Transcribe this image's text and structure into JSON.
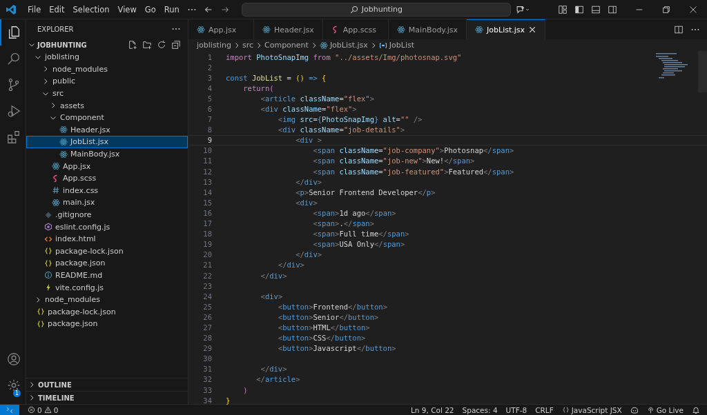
{
  "menu": [
    "File",
    "Edit",
    "Selection",
    "View",
    "Go",
    "Run"
  ],
  "search": {
    "value": "Jobhunting"
  },
  "activity": [
    {
      "kind": "explorer",
      "selected": true
    },
    {
      "kind": "search",
      "selected": false
    },
    {
      "kind": "source-control",
      "selected": false
    },
    {
      "kind": "run",
      "selected": false
    },
    {
      "kind": "extensions",
      "selected": false
    }
  ],
  "settings_badge": "1",
  "explorer": {
    "title": "EXPLORER",
    "root": {
      "label": "JOBHUNTING",
      "expanded": true
    },
    "tree": [
      {
        "label": "joblisting",
        "kind": "folder",
        "expanded": true,
        "selected": false,
        "children": [
          {
            "label": "node_modules",
            "kind": "folder",
            "expanded": false,
            "selected": false
          },
          {
            "label": "public",
            "kind": "folder",
            "expanded": false,
            "selected": false
          },
          {
            "label": "src",
            "kind": "folder",
            "expanded": true,
            "selected": false,
            "children": [
              {
                "label": "assets",
                "kind": "folder",
                "expanded": false,
                "selected": false
              },
              {
                "label": "Component",
                "kind": "folder",
                "expanded": true,
                "selected": false,
                "children": [
                  {
                    "label": "Header.jsx",
                    "kind": "react",
                    "selected": false
                  },
                  {
                    "label": "JobList.jsx",
                    "kind": "react",
                    "selected": true
                  },
                  {
                    "label": "MainBody.jsx",
                    "kind": "react",
                    "selected": false
                  }
                ]
              },
              {
                "label": "App.jsx",
                "kind": "react",
                "selected": false
              },
              {
                "label": "App.scss",
                "kind": "sass",
                "selected": false
              },
              {
                "label": "index.css",
                "kind": "css",
                "selected": false
              },
              {
                "label": "main.jsx",
                "kind": "react",
                "selected": false
              }
            ]
          },
          {
            "label": ".gitignore",
            "kind": "git",
            "selected": false
          },
          {
            "label": "eslint.config.js",
            "kind": "eslint",
            "selected": false
          },
          {
            "label": "index.html",
            "kind": "html",
            "selected": false
          },
          {
            "label": "package-lock.json",
            "kind": "json",
            "selected": false
          },
          {
            "label": "package.json",
            "kind": "json",
            "selected": false
          },
          {
            "label": "README.md",
            "kind": "info",
            "selected": false
          },
          {
            "label": "vite.config.js",
            "kind": "vite",
            "selected": false
          }
        ]
      },
      {
        "label": "node_modules",
        "kind": "folder",
        "expanded": false,
        "selected": false
      },
      {
        "label": "package-lock.json",
        "kind": "json",
        "selected": false
      },
      {
        "label": "package.json",
        "kind": "json",
        "selected": false
      }
    ],
    "sections": [
      {
        "label": "OUTLINE",
        "expanded": false
      },
      {
        "label": "TIMELINE",
        "expanded": false
      }
    ]
  },
  "tabs": [
    {
      "label": "App.jsx",
      "kind": "react",
      "selected": false
    },
    {
      "label": "Header.jsx",
      "kind": "react",
      "selected": false
    },
    {
      "label": "App.scss",
      "kind": "sass",
      "selected": false
    },
    {
      "label": "MainBody.jsx",
      "kind": "react",
      "selected": false
    },
    {
      "label": "JobList.jsx",
      "kind": "react",
      "selected": true
    }
  ],
  "breadcrumb": [
    {
      "label": "joblisting",
      "kind": "text"
    },
    {
      "label": "src",
      "kind": "text"
    },
    {
      "label": "Component",
      "kind": "text"
    },
    {
      "label": "JobList.jsx",
      "kind": "react"
    },
    {
      "label": "JobList",
      "kind": "symbol"
    }
  ],
  "code": [
    {
      "number": "1",
      "active": false,
      "tokens": [
        {
          "kind": "kw",
          "text": "import"
        },
        {
          "kind": "var",
          "text": " PhotoSnapImg"
        },
        {
          "kind": "kw",
          "text": " from"
        },
        {
          "kind": "str",
          "text": " \"../assets/Img/photosnap.svg\""
        }
      ]
    },
    {
      "number": "2",
      "active": false
    },
    {
      "number": "3",
      "active": false,
      "tokens": [
        {
          "kind": "decl",
          "text": "const"
        },
        {
          "kind": "fn",
          "text": " JobList"
        },
        {
          "kind": "op",
          "text": " = "
        },
        {
          "kind": "brace",
          "text": "()"
        },
        {
          "kind": "decl",
          "text": " =>"
        },
        {
          "kind": "brace",
          "text": " {"
        }
      ]
    },
    {
      "number": "4",
      "active": false,
      "tokens": [
        {
          "kind": "kw",
          "text": "    return"
        },
        {
          "kind": "paren",
          "text": "("
        }
      ]
    },
    {
      "number": "5",
      "active": false,
      "tokens": [
        {
          "kind": "tp",
          "text": "        <"
        },
        {
          "kind": "tag",
          "text": "article"
        },
        {
          "kind": "attr",
          "text": " className"
        },
        {
          "kind": "op",
          "text": "="
        },
        {
          "kind": "str",
          "text": "\"flex\""
        },
        {
          "kind": "tp",
          "text": ">"
        }
      ]
    },
    {
      "number": "6",
      "active": false,
      "tokens": [
        {
          "kind": "tp",
          "text": "        <"
        },
        {
          "kind": "tag",
          "text": "div"
        },
        {
          "kind": "attr",
          "text": " className"
        },
        {
          "kind": "op",
          "text": "="
        },
        {
          "kind": "str",
          "text": "\"flex\""
        },
        {
          "kind": "tp",
          "text": ">"
        }
      ]
    },
    {
      "number": "7",
      "active": false,
      "tokens": [
        {
          "kind": "tp",
          "text": "            <"
        },
        {
          "kind": "tag",
          "text": "img"
        },
        {
          "kind": "attr",
          "text": " src"
        },
        {
          "kind": "op",
          "text": "="
        },
        {
          "kind": "tag",
          "text": "{"
        },
        {
          "kind": "var",
          "text": "PhotoSnapImg"
        },
        {
          "kind": "tag",
          "text": "}"
        },
        {
          "kind": "attr",
          "text": " alt"
        },
        {
          "kind": "op",
          "text": "="
        },
        {
          "kind": "str",
          "text": "\"\""
        },
        {
          "kind": "tp",
          "text": " />"
        }
      ]
    },
    {
      "number": "8",
      "active": false,
      "tokens": [
        {
          "kind": "tp",
          "text": "            <"
        },
        {
          "kind": "tag",
          "text": "div"
        },
        {
          "kind": "attr",
          "text": " className"
        },
        {
          "kind": "op",
          "text": "="
        },
        {
          "kind": "str",
          "text": "\"job-details\""
        },
        {
          "kind": "tp",
          "text": ">"
        }
      ]
    },
    {
      "number": "9",
      "active": true,
      "tokens": [
        {
          "kind": "tp",
          "text": "                <"
        },
        {
          "kind": "tag",
          "text": "div"
        },
        {
          "kind": "tp",
          "text": " >"
        }
      ]
    },
    {
      "number": "10",
      "active": false,
      "tokens": [
        {
          "kind": "tp",
          "text": "                    <"
        },
        {
          "kind": "tag",
          "text": "span"
        },
        {
          "kind": "attr",
          "text": " className"
        },
        {
          "kind": "op",
          "text": "="
        },
        {
          "kind": "str",
          "text": "\"job-company\""
        },
        {
          "kind": "tp",
          "text": ">"
        },
        {
          "kind": "txt",
          "text": "Photosnap"
        },
        {
          "kind": "tp",
          "text": "</"
        },
        {
          "kind": "tag",
          "text": "span"
        },
        {
          "kind": "tp",
          "text": ">"
        }
      ]
    },
    {
      "number": "11",
      "active": false,
      "tokens": [
        {
          "kind": "tp",
          "text": "                    <"
        },
        {
          "kind": "tag",
          "text": "span"
        },
        {
          "kind": "attr",
          "text": " className"
        },
        {
          "kind": "op",
          "text": "="
        },
        {
          "kind": "str",
          "text": "\"job-new\""
        },
        {
          "kind": "tp",
          "text": ">"
        },
        {
          "kind": "txt",
          "text": "New!"
        },
        {
          "kind": "tp",
          "text": "</"
        },
        {
          "kind": "tag",
          "text": "span"
        },
        {
          "kind": "tp",
          "text": ">"
        }
      ]
    },
    {
      "number": "12",
      "active": false,
      "tokens": [
        {
          "kind": "tp",
          "text": "                    <"
        },
        {
          "kind": "tag",
          "text": "span"
        },
        {
          "kind": "attr",
          "text": " className"
        },
        {
          "kind": "op",
          "text": "="
        },
        {
          "kind": "str",
          "text": "\"job-featured\""
        },
        {
          "kind": "tp",
          "text": ">"
        },
        {
          "kind": "txt",
          "text": "Featured"
        },
        {
          "kind": "tp",
          "text": "</"
        },
        {
          "kind": "tag",
          "text": "span"
        },
        {
          "kind": "tp",
          "text": ">"
        }
      ]
    },
    {
      "number": "13",
      "active": false,
      "tokens": [
        {
          "kind": "tp",
          "text": "                </"
        },
        {
          "kind": "tag",
          "text": "div"
        },
        {
          "kind": "tp",
          "text": ">"
        }
      ]
    },
    {
      "number": "14",
      "active": false,
      "tokens": [
        {
          "kind": "tp",
          "text": "                <"
        },
        {
          "kind": "tag",
          "text": "p"
        },
        {
          "kind": "tp",
          "text": ">"
        },
        {
          "kind": "txt",
          "text": "Senior Frontend Developer"
        },
        {
          "kind": "tp",
          "text": "</"
        },
        {
          "kind": "tag",
          "text": "p"
        },
        {
          "kind": "tp",
          "text": ">"
        }
      ]
    },
    {
      "number": "15",
      "active": false,
      "tokens": [
        {
          "kind": "tp",
          "text": "                <"
        },
        {
          "kind": "tag",
          "text": "div"
        },
        {
          "kind": "tp",
          "text": ">"
        }
      ]
    },
    {
      "number": "16",
      "active": false,
      "tokens": [
        {
          "kind": "tp",
          "text": "                    <"
        },
        {
          "kind": "tag",
          "text": "span"
        },
        {
          "kind": "tp",
          "text": ">"
        },
        {
          "kind": "txt",
          "text": "1d ago"
        },
        {
          "kind": "tp",
          "text": "</"
        },
        {
          "kind": "tag",
          "text": "span"
        },
        {
          "kind": "tp",
          "text": ">"
        }
      ]
    },
    {
      "number": "17",
      "active": false,
      "tokens": [
        {
          "kind": "tp",
          "text": "                    <"
        },
        {
          "kind": "tag",
          "text": "span"
        },
        {
          "kind": "tp",
          "text": ">"
        },
        {
          "kind": "txt",
          "text": "."
        },
        {
          "kind": "tp",
          "text": "</"
        },
        {
          "kind": "tag",
          "text": "span"
        },
        {
          "kind": "tp",
          "text": ">"
        }
      ]
    },
    {
      "number": "18",
      "active": false,
      "tokens": [
        {
          "kind": "tp",
          "text": "                    <"
        },
        {
          "kind": "tag",
          "text": "span"
        },
        {
          "kind": "tp",
          "text": ">"
        },
        {
          "kind": "txt",
          "text": "Full time"
        },
        {
          "kind": "tp",
          "text": "</"
        },
        {
          "kind": "tag",
          "text": "span"
        },
        {
          "kind": "tp",
          "text": ">"
        }
      ]
    },
    {
      "number": "19",
      "active": false,
      "tokens": [
        {
          "kind": "tp",
          "text": "                    <"
        },
        {
          "kind": "tag",
          "text": "span"
        },
        {
          "kind": "tp",
          "text": ">"
        },
        {
          "kind": "txt",
          "text": "USA Only"
        },
        {
          "kind": "tp",
          "text": "</"
        },
        {
          "kind": "tag",
          "text": "span"
        },
        {
          "kind": "tp",
          "text": ">"
        }
      ]
    },
    {
      "number": "20",
      "active": false,
      "tokens": [
        {
          "kind": "tp",
          "text": "                </"
        },
        {
          "kind": "tag",
          "text": "div"
        },
        {
          "kind": "tp",
          "text": ">"
        }
      ]
    },
    {
      "number": "21",
      "active": false,
      "tokens": [
        {
          "kind": "tp",
          "text": "            </"
        },
        {
          "kind": "tag",
          "text": "div"
        },
        {
          "kind": "tp",
          "text": ">"
        }
      ]
    },
    {
      "number": "22",
      "active": false,
      "tokens": [
        {
          "kind": "tp",
          "text": "        </"
        },
        {
          "kind": "tag",
          "text": "div"
        },
        {
          "kind": "tp",
          "text": ">"
        }
      ]
    },
    {
      "number": "23",
      "active": false
    },
    {
      "number": "24",
      "active": false,
      "tokens": [
        {
          "kind": "tp",
          "text": "        <"
        },
        {
          "kind": "tag",
          "text": "div"
        },
        {
          "kind": "tp",
          "text": ">"
        }
      ]
    },
    {
      "number": "25",
      "active": false,
      "tokens": [
        {
          "kind": "tp",
          "text": "            <"
        },
        {
          "kind": "tag",
          "text": "button"
        },
        {
          "kind": "tp",
          "text": ">"
        },
        {
          "kind": "txt",
          "text": "Frontend"
        },
        {
          "kind": "tp",
          "text": "</"
        },
        {
          "kind": "tag",
          "text": "button"
        },
        {
          "kind": "tp",
          "text": ">"
        }
      ]
    },
    {
      "number": "26",
      "active": false,
      "tokens": [
        {
          "kind": "tp",
          "text": "            <"
        },
        {
          "kind": "tag",
          "text": "button"
        },
        {
          "kind": "tp",
          "text": ">"
        },
        {
          "kind": "txt",
          "text": "Senior"
        },
        {
          "kind": "tp",
          "text": "</"
        },
        {
          "kind": "tag",
          "text": "button"
        },
        {
          "kind": "tp",
          "text": ">"
        }
      ]
    },
    {
      "number": "27",
      "active": false,
      "tokens": [
        {
          "kind": "tp",
          "text": "            <"
        },
        {
          "kind": "tag",
          "text": "button"
        },
        {
          "kind": "tp",
          "text": ">"
        },
        {
          "kind": "txt",
          "text": "HTML"
        },
        {
          "kind": "tp",
          "text": "</"
        },
        {
          "kind": "tag",
          "text": "button"
        },
        {
          "kind": "tp",
          "text": ">"
        }
      ]
    },
    {
      "number": "28",
      "active": false,
      "tokens": [
        {
          "kind": "tp",
          "text": "            <"
        },
        {
          "kind": "tag",
          "text": "button"
        },
        {
          "kind": "tp",
          "text": ">"
        },
        {
          "kind": "txt",
          "text": "CSS"
        },
        {
          "kind": "tp",
          "text": "</"
        },
        {
          "kind": "tag",
          "text": "button"
        },
        {
          "kind": "tp",
          "text": ">"
        }
      ]
    },
    {
      "number": "29",
      "active": false,
      "tokens": [
        {
          "kind": "tp",
          "text": "            <"
        },
        {
          "kind": "tag",
          "text": "button"
        },
        {
          "kind": "tp",
          "text": ">"
        },
        {
          "kind": "txt",
          "text": "Javascript"
        },
        {
          "kind": "tp",
          "text": "</"
        },
        {
          "kind": "tag",
          "text": "button"
        },
        {
          "kind": "tp",
          "text": ">"
        }
      ]
    },
    {
      "number": "30",
      "active": false
    },
    {
      "number": "31",
      "active": false,
      "tokens": [
        {
          "kind": "tp",
          "text": "        </"
        },
        {
          "kind": "tag",
          "text": "div"
        },
        {
          "kind": "tp",
          "text": ">"
        }
      ]
    },
    {
      "number": "32",
      "active": false,
      "tokens": [
        {
          "kind": "tp",
          "text": "       </"
        },
        {
          "kind": "tag",
          "text": "article"
        },
        {
          "kind": "tp",
          "text": ">"
        }
      ]
    },
    {
      "number": "33",
      "active": false,
      "tokens": [
        {
          "kind": "paren",
          "text": "    )"
        }
      ]
    },
    {
      "number": "34",
      "active": false,
      "tokens": [
        {
          "kind": "brace",
          "text": "}"
        }
      ]
    }
  ],
  "status_bar": {
    "errors": "0",
    "warnings": "0",
    "items": [
      {
        "label": "Ln 9, Col 22",
        "kind": "text"
      },
      {
        "label": "Spaces: 4",
        "kind": "text"
      },
      {
        "label": "UTF-8",
        "kind": "text"
      },
      {
        "label": "CRLF",
        "kind": "text"
      },
      {
        "label": "JavaScript JSX",
        "kind": "language"
      },
      {
        "kind": "copilot"
      },
      {
        "label": "Go Live",
        "kind": "live"
      },
      {
        "kind": "bell"
      }
    ]
  }
}
